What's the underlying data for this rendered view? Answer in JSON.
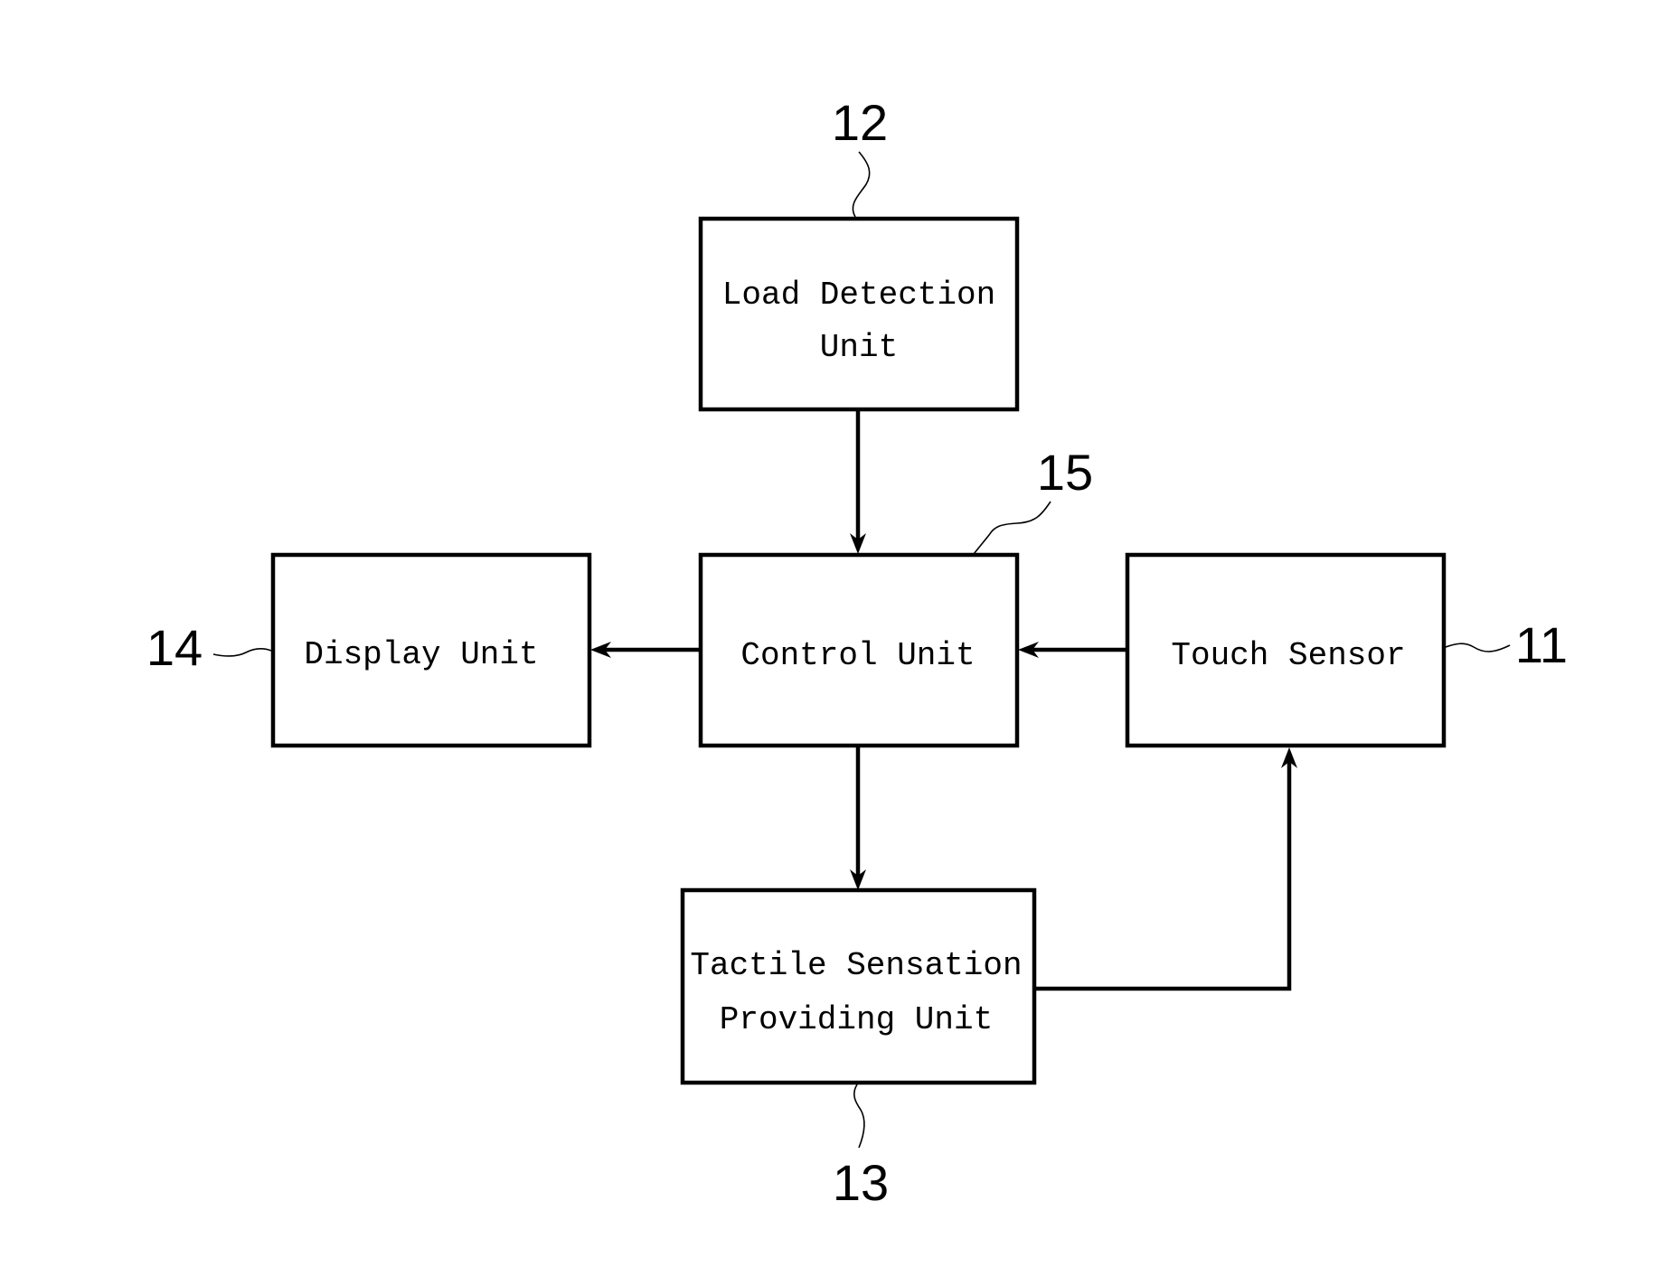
{
  "diagram": {
    "type": "block-diagram",
    "background_color": "#ffffff",
    "line_color": "#000000",
    "blocks": [
      {
        "id": "load-detection",
        "ref": "12",
        "lines": [
          "Load Detection",
          "Unit"
        ]
      },
      {
        "id": "display",
        "ref": "14",
        "lines": [
          "Display Unit"
        ]
      },
      {
        "id": "control",
        "ref": "15",
        "lines": [
          "Control Unit"
        ]
      },
      {
        "id": "touch-sensor",
        "ref": "11",
        "lines": [
          "Touch Sensor"
        ]
      },
      {
        "id": "tactile",
        "ref": "13",
        "lines": [
          "Tactile Sensation",
          "Providing Unit"
        ]
      }
    ],
    "connections": [
      {
        "from": "load-detection",
        "to": "control",
        "direction": "down"
      },
      {
        "from": "control",
        "to": "display",
        "direction": "left"
      },
      {
        "from": "touch-sensor",
        "to": "control",
        "direction": "left"
      },
      {
        "from": "control",
        "to": "tactile",
        "direction": "down"
      },
      {
        "from": "tactile",
        "to": "touch-sensor",
        "direction": "right-then-up"
      }
    ]
  }
}
